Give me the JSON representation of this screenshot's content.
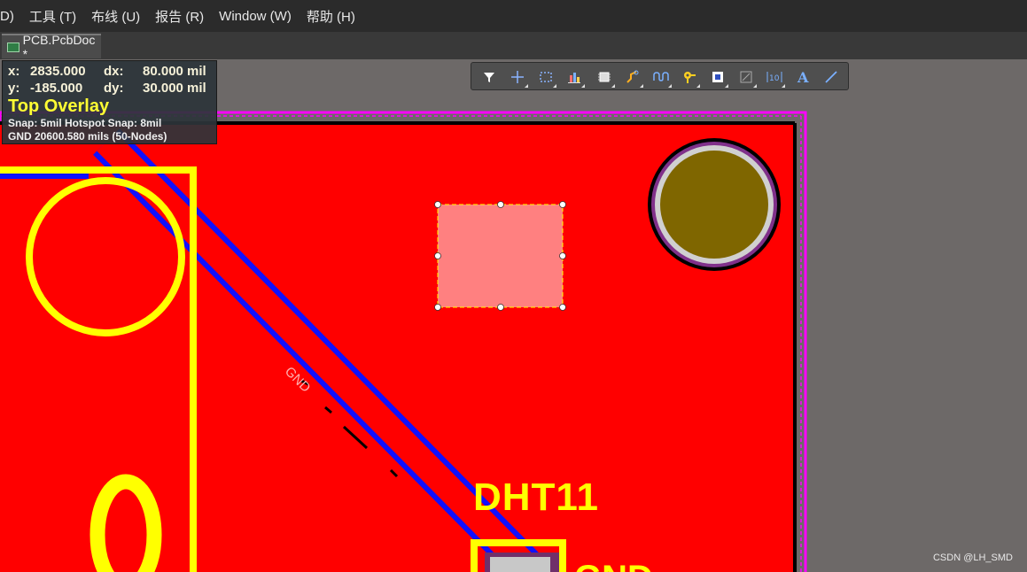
{
  "menu": [
    "D)",
    "工具 (T)",
    "布线 (U)",
    "报告 (R)",
    "Window (W)",
    "帮助 (H)"
  ],
  "tab": {
    "label": "PCB.PcbDoc *"
  },
  "hud": {
    "x_label": "x:",
    "x_value": "2835.000",
    "dx_label": "dx:",
    "dx_value": "80.000 mil",
    "y_label": "y:",
    "y_value": "-185.000",
    "dy_label": "dy:",
    "dy_value": "30.000 mil",
    "layer": "Top Overlay",
    "snap": "Snap: 5mil Hotspot Snap: 8mil",
    "net": "GND  20600.580 mils (50-Nodes)"
  },
  "toolbar": {
    "tools": [
      "filter-icon",
      "crosshair-icon",
      "select-rect-icon",
      "align-icon",
      "component-icon",
      "route-icon",
      "tune-icon",
      "via-icon",
      "fill-icon",
      "region-icon",
      "dimension-icon",
      "text-icon",
      "line-icon"
    ]
  },
  "board": {
    "net_label": "GND",
    "component_designator": "DHT11",
    "pin_text": "0",
    "partial_label": "GND"
  },
  "colors": {
    "copper": "#ff0000",
    "overlay": "#ffff00",
    "trace": "#1010ff",
    "keepout": "#ff00ff",
    "pad_selected": "#ff8080",
    "hole": "#7f6600"
  },
  "watermark": "CSDN @LH_SMD"
}
